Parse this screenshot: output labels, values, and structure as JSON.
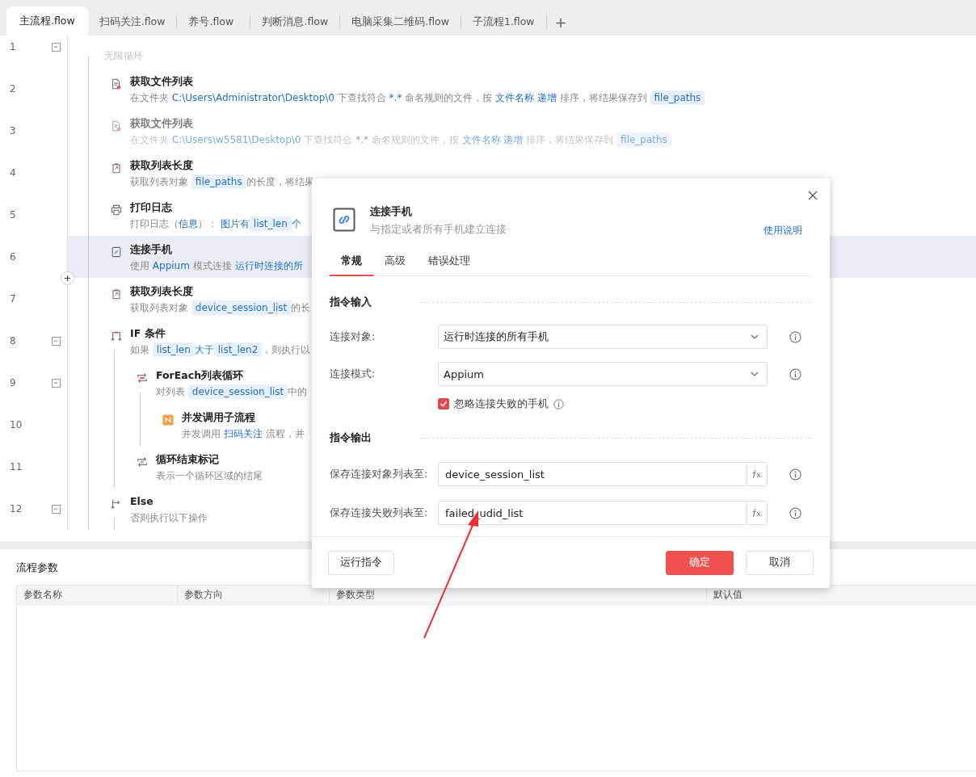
{
  "tabs": [
    {
      "label": "主流程.flow",
      "selected": true
    },
    {
      "label": "扫码关注.flow",
      "selected": false
    },
    {
      "label": "养号.flow",
      "selected": false
    },
    {
      "label": "判断消息.flow",
      "selected": false
    },
    {
      "label": "电脑采集二维码.flow",
      "selected": false
    },
    {
      "label": "子流程1.flow",
      "selected": false
    }
  ],
  "add_tab": "+",
  "editor": {
    "rows": [
      {
        "line": "1",
        "expanded": true,
        "disabled": true,
        "selected": false,
        "hovered": false,
        "description": [
          {
            "kind": "plain",
            "text": "无限循环"
          }
        ],
        "children": [
          {
            "line": "2",
            "kind": "file",
            "title": "获取文件列表",
            "disabled": false,
            "selected": false,
            "hovered": false,
            "description": [
              {
                "kind": "plain",
                "text": "在文件夹 "
              },
              {
                "kind": "link",
                "text": "C:\\Users\\Administrator\\Desktop\\0"
              },
              {
                "kind": "plain",
                "text": " 下查找符合 "
              },
              {
                "kind": "link",
                "text": "*.*"
              },
              {
                "kind": "plain",
                "text": " 命名规则的文件，按 "
              },
              {
                "kind": "link",
                "text": "文件名称 递增"
              },
              {
                "kind": "plain",
                "text": " 排序，将结果保存到 "
              },
              {
                "kind": "chip",
                "text": "file_paths"
              }
            ]
          },
          {
            "line": "3",
            "kind": "file",
            "title": "获取文件列表",
            "disabled": true,
            "selected": false,
            "hovered": false,
            "description": [
              {
                "kind": "plain",
                "text": "在文件夹 "
              },
              {
                "kind": "link",
                "text": "C:\\Users\\w5581\\Desktop\\0"
              },
              {
                "kind": "plain",
                "text": " 下查找符合 "
              },
              {
                "kind": "link",
                "text": "*.*"
              },
              {
                "kind": "plain",
                "text": " 命名规则的文件，按 "
              },
              {
                "kind": "link",
                "text": "文件名称 递增"
              },
              {
                "kind": "plain",
                "text": " 排序，将结果保存到 "
              },
              {
                "kind": "chip",
                "text": "file_paths"
              }
            ]
          },
          {
            "line": "4",
            "kind": "list",
            "title": "获取列表长度",
            "disabled": false,
            "selected": false,
            "hovered": false,
            "description": [
              {
                "kind": "plain",
                "text": "获取列表对象 "
              },
              {
                "kind": "chip",
                "text": "file_paths"
              },
              {
                "kind": "plain",
                "text": "的长度，将结果"
              }
            ]
          },
          {
            "line": "5",
            "kind": "print",
            "title": "打印日志",
            "disabled": false,
            "selected": false,
            "hovered": false,
            "description": [
              {
                "kind": "plain",
                "text": "打印日志（"
              },
              {
                "kind": "link",
                "text": "信息"
              },
              {
                "kind": "plain",
                "text": "）： "
              },
              {
                "kind": "link",
                "text": "图片有"
              },
              {
                "kind": "chip",
                "text": "list_len"
              },
              {
                "kind": "link",
                "text": "个"
              }
            ]
          },
          {
            "line": "6",
            "kind": "phone",
            "title": "连接手机",
            "disabled": false,
            "selected": true,
            "hovered": true,
            "description": [
              {
                "kind": "plain",
                "text": "使用 "
              },
              {
                "kind": "link",
                "text": "Appium"
              },
              {
                "kind": "plain",
                "text": " 模式连接 "
              },
              {
                "kind": "link",
                "text": "运行时连接的所"
              }
            ]
          },
          {
            "line": "7",
            "kind": "list",
            "title": "获取列表长度",
            "disabled": false,
            "selected": false,
            "hovered": false,
            "description": [
              {
                "kind": "plain",
                "text": "获取列表对象 "
              },
              {
                "kind": "chip",
                "text": "device_session_list"
              },
              {
                "kind": "plain",
                "text": "的长"
              }
            ]
          },
          {
            "line": "8",
            "kind": "if",
            "title": "IF 条件",
            "expanded": true,
            "disabled": false,
            "selected": false,
            "hovered": false,
            "description": [
              {
                "kind": "plain",
                "text": "如果 "
              },
              {
                "kind": "chip",
                "text": "list_len"
              },
              {
                "kind": "link",
                "text": "大于"
              },
              {
                "kind": "chip",
                "text": "list_len2"
              },
              {
                "kind": "plain",
                "text": "，则执行以"
              }
            ],
            "children": [
              {
                "line": "9",
                "kind": "loop",
                "title": "ForEach列表循环",
                "expanded": true,
                "disabled": false,
                "selected": false,
                "hovered": false,
                "description": [
                  {
                    "kind": "plain",
                    "text": "对列表 "
                  },
                  {
                    "kind": "chip",
                    "text": "device_session_list"
                  },
                  {
                    "kind": "plain",
                    "text": "中的"
                  }
                ],
                "children": [
                  {
                    "line": "10",
                    "kind": "parallel",
                    "title": "并发调用子流程",
                    "disabled": false,
                    "selected": false,
                    "hovered": false,
                    "description": [
                      {
                        "kind": "plain",
                        "text": "并发调用 "
                      },
                      {
                        "kind": "link",
                        "text": "扫码关注"
                      },
                      {
                        "kind": "plain",
                        "text": " 流程，并"
                      }
                    ]
                  }
                ]
              },
              {
                "line": "11",
                "kind": "loop-end",
                "title": "循环结束标记",
                "disabled": false,
                "selected": false,
                "hovered": false,
                "description": [
                  {
                    "kind": "plain",
                    "text": "表示一个循环区域的结尾"
                  }
                ]
              }
            ]
          },
          {
            "line": "12",
            "kind": "else",
            "title": "Else",
            "expanded": true,
            "disabled": false,
            "selected": false,
            "hovered": false,
            "description": [
              {
                "kind": "plain",
                "text": "否则执行以下操作"
              }
            ]
          }
        ]
      }
    ]
  },
  "dialog": {
    "title": "连接手机",
    "subtitle": "与指定或者所有手机建立连接",
    "help": "使用说明",
    "tabs": [
      {
        "label": "常规",
        "selected": true
      },
      {
        "label": "高级",
        "selected": false
      },
      {
        "label": "错误处理",
        "selected": false
      }
    ],
    "sections": [
      {
        "title": "指令输入",
        "fields": [
          {
            "kind": "select",
            "label": "连接对象:",
            "value": "运行时连接的所有手机"
          },
          {
            "kind": "select",
            "label": "连接模式:",
            "value": "Appium"
          },
          {
            "kind": "checkbox",
            "label": "忽略连接失败的手机",
            "checked": true
          }
        ]
      },
      {
        "title": "指令输出",
        "fields": [
          {
            "kind": "variable",
            "label": "保存连接对象列表至:",
            "value": "device_session_list"
          },
          {
            "kind": "variable",
            "label": "保存连接失败列表至:",
            "value": "failed_udid_list"
          }
        ]
      }
    ],
    "run_button": "运行指令",
    "ok_button": "确定",
    "cancel_button": "取消"
  },
  "params": {
    "title": "流程参数",
    "columns": [
      "参数名称",
      "参数方向",
      "参数类型",
      "默认值"
    ]
  }
}
